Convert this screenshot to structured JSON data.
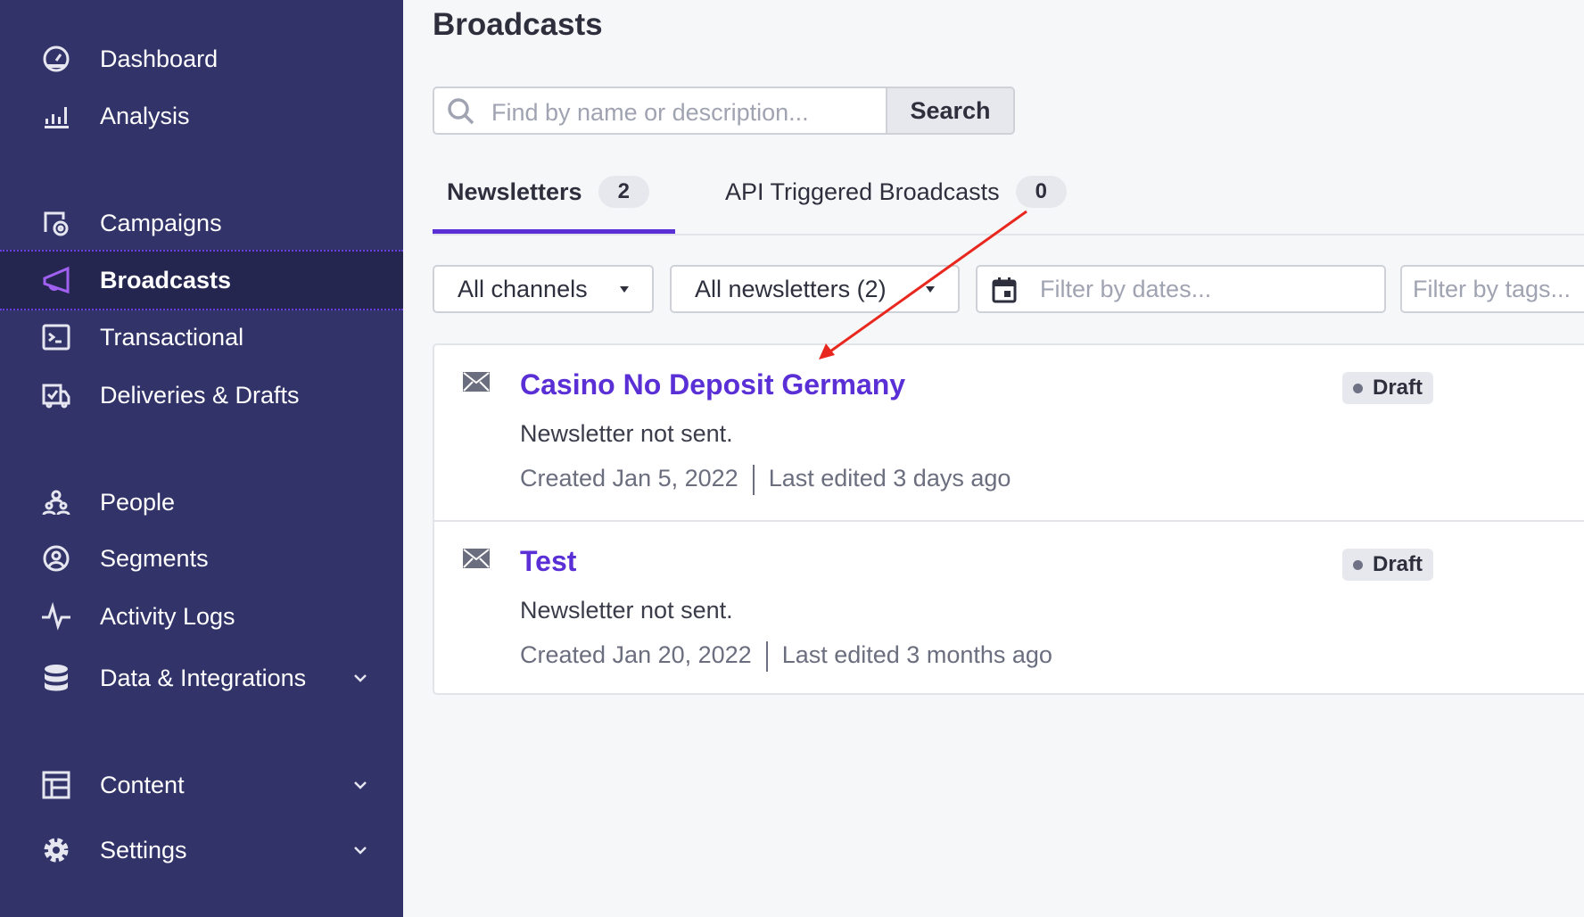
{
  "sidebar": {
    "items": [
      {
        "label": "Dashboard",
        "icon": "dashboard-icon"
      },
      {
        "label": "Analysis",
        "icon": "bar-chart-icon"
      },
      {
        "label": "Campaigns",
        "icon": "campaigns-icon"
      },
      {
        "label": "Broadcasts",
        "icon": "megaphone-icon",
        "active": true
      },
      {
        "label": "Transactional",
        "icon": "terminal-icon"
      },
      {
        "label": "Deliveries & Drafts",
        "icon": "delivery-truck-icon"
      },
      {
        "label": "People",
        "icon": "people-icon"
      },
      {
        "label": "Segments",
        "icon": "segments-icon"
      },
      {
        "label": "Activity Logs",
        "icon": "activity-icon"
      },
      {
        "label": "Data & Integrations",
        "icon": "database-icon"
      },
      {
        "label": "Content",
        "icon": "content-icon"
      },
      {
        "label": "Settings",
        "icon": "gear-icon"
      }
    ]
  },
  "page": {
    "title": "Broadcasts"
  },
  "search": {
    "placeholder": "Find by name or description...",
    "button": "Search"
  },
  "tabs": [
    {
      "label": "Newsletters",
      "count": "2"
    },
    {
      "label": "API Triggered Broadcasts",
      "count": "0"
    }
  ],
  "filters": {
    "channels": "All channels",
    "newsletters": "All newsletters (2)",
    "dates_placeholder": "Filter by dates...",
    "tags_placeholder": "Filter by tags..."
  },
  "broadcasts": [
    {
      "title": "Casino No Deposit Germany",
      "status_text": "Newsletter not sent.",
      "created": "Created Jan 5, 2022",
      "edited": "Last edited 3 days ago",
      "badge": "Draft"
    },
    {
      "title": "Test",
      "status_text": "Newsletter not sent.",
      "created": "Created Jan 20, 2022",
      "edited": "Last edited 3 months ago",
      "badge": "Draft"
    }
  ],
  "colors": {
    "sidebar": "#323368",
    "accent": "#5a2fd6",
    "annotation": "#e8281e"
  }
}
